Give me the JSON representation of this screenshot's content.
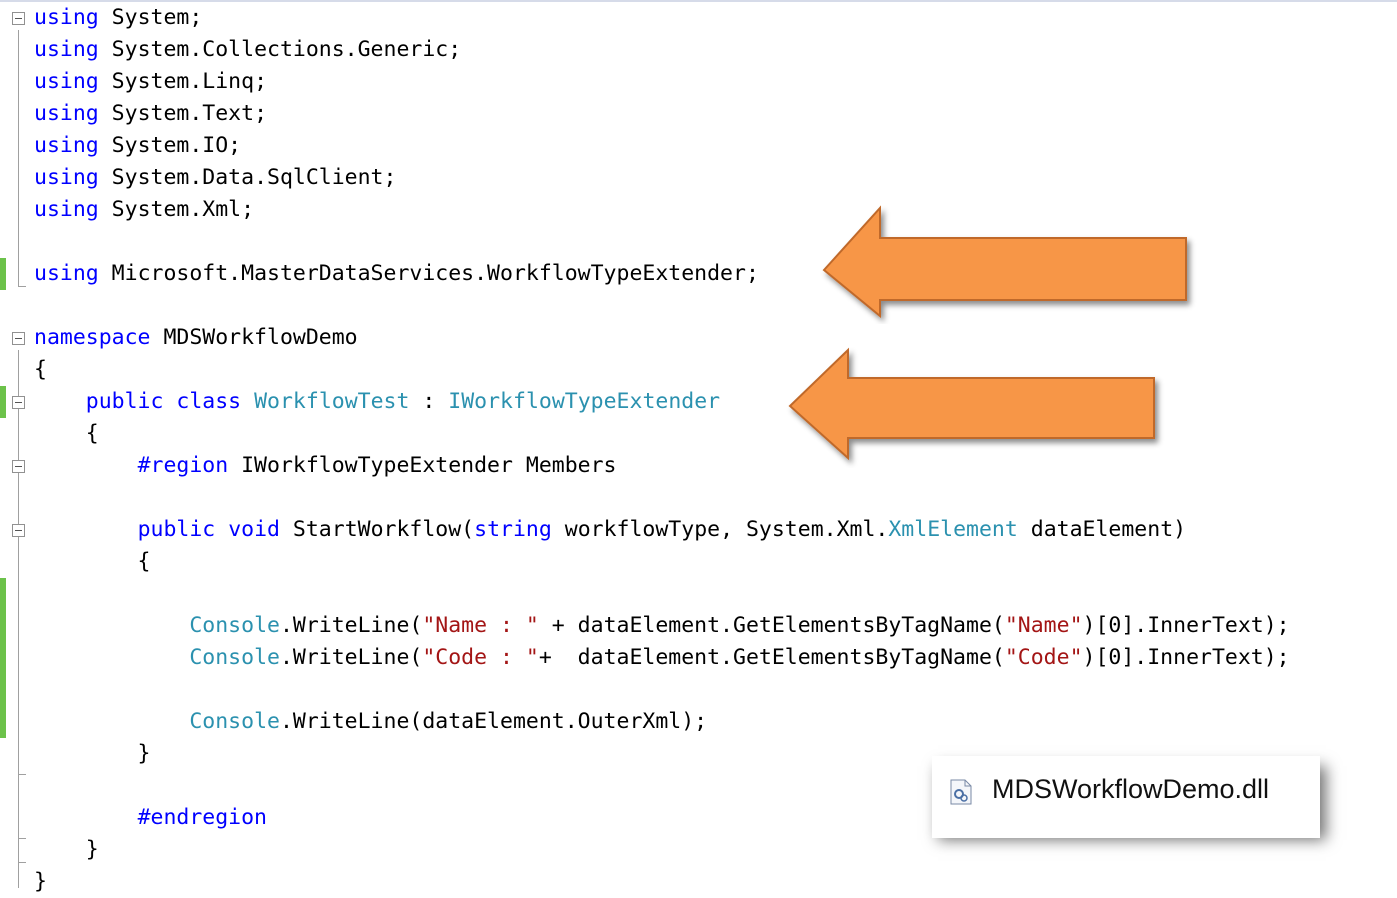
{
  "code_lines": [
    {
      "segments": [
        [
          "kw",
          "using"
        ],
        [
          "p",
          " System;"
        ]
      ]
    },
    {
      "segments": [
        [
          "kw",
          "using"
        ],
        [
          "p",
          " System.Collections.Generic;"
        ]
      ]
    },
    {
      "segments": [
        [
          "kw",
          "using"
        ],
        [
          "p",
          " System.Linq;"
        ]
      ]
    },
    {
      "segments": [
        [
          "kw",
          "using"
        ],
        [
          "p",
          " System.Text;"
        ]
      ]
    },
    {
      "segments": [
        [
          "kw",
          "using"
        ],
        [
          "p",
          " System.IO;"
        ]
      ]
    },
    {
      "segments": [
        [
          "kw",
          "using"
        ],
        [
          "p",
          " System.Data.SqlClient;"
        ]
      ]
    },
    {
      "segments": [
        [
          "kw",
          "using"
        ],
        [
          "p",
          " System.Xml;"
        ]
      ]
    },
    {
      "segments": []
    },
    {
      "segments": [
        [
          "kw",
          "using"
        ],
        [
          "p",
          " Microsoft.MasterDataServices.WorkflowTypeExtender;"
        ]
      ]
    },
    {
      "segments": []
    },
    {
      "segments": [
        [
          "kw",
          "namespace"
        ],
        [
          "p",
          " MDSWorkflowDemo"
        ]
      ]
    },
    {
      "segments": [
        [
          "p",
          "{"
        ]
      ]
    },
    {
      "segments": [
        [
          "p",
          "    "
        ],
        [
          "kw",
          "public"
        ],
        [
          "p",
          " "
        ],
        [
          "kw",
          "class"
        ],
        [
          "p",
          " "
        ],
        [
          "ty",
          "WorkflowTest"
        ],
        [
          "p",
          " : "
        ],
        [
          "ty",
          "IWorkflowTypeExtender"
        ]
      ]
    },
    {
      "segments": [
        [
          "p",
          "    {"
        ]
      ]
    },
    {
      "segments": [
        [
          "p",
          "        "
        ],
        [
          "kw",
          "#region"
        ],
        [
          "p",
          " IWorkflowTypeExtender Members"
        ]
      ]
    },
    {
      "segments": []
    },
    {
      "segments": [
        [
          "p",
          "        "
        ],
        [
          "kw",
          "public"
        ],
        [
          "p",
          " "
        ],
        [
          "kw",
          "void"
        ],
        [
          "p",
          " StartWorkflow("
        ],
        [
          "kw",
          "string"
        ],
        [
          "p",
          " workflowType, System.Xml."
        ],
        [
          "ty",
          "XmlElement"
        ],
        [
          "p",
          " dataElement)"
        ]
      ]
    },
    {
      "segments": [
        [
          "p",
          "        {"
        ]
      ]
    },
    {
      "segments": []
    },
    {
      "segments": [
        [
          "p",
          "            "
        ],
        [
          "ty",
          "Console"
        ],
        [
          "p",
          ".WriteLine("
        ],
        [
          "st",
          "\"Name : \""
        ],
        [
          "p",
          " + dataElement.GetElementsByTagName("
        ],
        [
          "st",
          "\"Name\""
        ],
        [
          "p",
          ")[0].InnerText);"
        ]
      ]
    },
    {
      "segments": [
        [
          "p",
          "            "
        ],
        [
          "ty",
          "Console"
        ],
        [
          "p",
          ".WriteLine("
        ],
        [
          "st",
          "\"Code : \""
        ],
        [
          "p",
          "+  dataElement.GetElementsByTagName("
        ],
        [
          "st",
          "\"Code\""
        ],
        [
          "p",
          ")[0].InnerText);"
        ]
      ]
    },
    {
      "segments": []
    },
    {
      "segments": [
        [
          "p",
          "            "
        ],
        [
          "ty",
          "Console"
        ],
        [
          "p",
          ".WriteLine(dataElement.OuterXml);"
        ]
      ]
    },
    {
      "segments": [
        [
          "p",
          "        }"
        ]
      ]
    },
    {
      "segments": []
    },
    {
      "segments": [
        [
          "p",
          "        "
        ],
        [
          "kw",
          "#endregion"
        ]
      ]
    },
    {
      "segments": [
        [
          "p",
          "    }"
        ]
      ]
    },
    {
      "segments": [
        [
          "p",
          "}"
        ]
      ]
    }
  ],
  "dll_file": {
    "name": "MDSWorkflowDemo.dll",
    "icon": "dll-file-icon"
  },
  "colors": {
    "keyword": "#0000ff",
    "type": "#2b91af",
    "string": "#a31515",
    "arrow": "#f79646",
    "change_margin": "#6cc24a"
  }
}
